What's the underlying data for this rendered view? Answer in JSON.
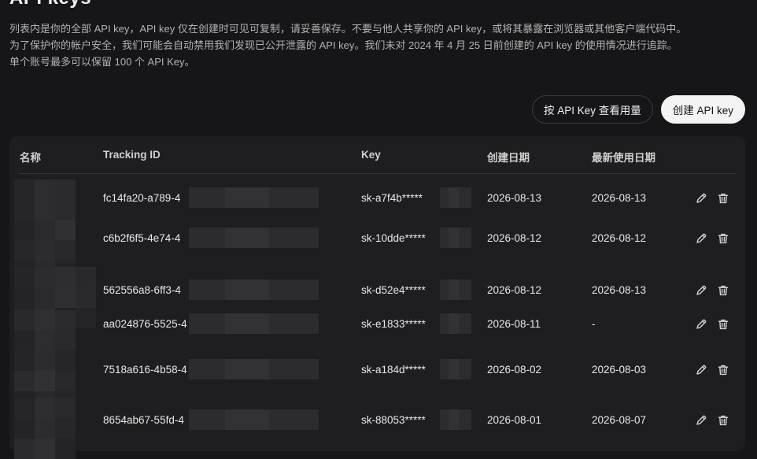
{
  "page": {
    "title": "API keys",
    "description": [
      "列表内是你的全部 API key，API key 仅在创建时可见可复制，请妥善保存。不要与他人共享你的 API key，或将其暴露在浏览器或其他客户端代码中。",
      "为了保护你的帐户安全，我们可能会自动禁用我们发现已公开泄露的 API key。我们未对 2024 年 4 月 25 日前创建的 API key 的使用情况进行追踪。",
      "单个账号最多可以保留 100 个 API Key。"
    ]
  },
  "actions": {
    "usage_label": "按 API Key 查看用量",
    "create_label": "创建 API key"
  },
  "table": {
    "headers": {
      "name": "名称",
      "tracking": "Tracking ID",
      "key": "Key",
      "created": "创建日期",
      "last_used": "最新使用日期"
    },
    "rows": [
      {
        "tracking": "fc14fa20-a789-4",
        "key": "sk-a7f4b*****",
        "created": "2026-08-13",
        "last_used": "2026-08-13"
      },
      {
        "tracking": "c6b2f6f5-4e74-4",
        "key": "sk-10dde*****",
        "created": "2026-08-12",
        "last_used": "2026-08-12"
      },
      {
        "tracking": "562556a8-6ff3-4",
        "key": "sk-d52e4*****",
        "created": "2026-08-12",
        "last_used": "2026-08-13"
      },
      {
        "tracking": "aa024876-5525-4",
        "key": "sk-e1833*****",
        "created": "2026-08-11",
        "last_used": "-"
      },
      {
        "tracking": "7518a616-4b58-4",
        "key": "sk-a184d*****",
        "created": "2026-08-02",
        "last_used": "2026-08-03"
      },
      {
        "tracking": "8654ab67-55fd-4",
        "key": "sk-88053*****",
        "created": "2026-08-01",
        "last_used": "2026-08-07"
      }
    ]
  },
  "icons": {
    "edit": "pencil-icon",
    "delete": "trash-icon"
  },
  "colors": {
    "background": "#161618",
    "card": "#1e1e20",
    "primary_button": "#f4f4f4"
  }
}
